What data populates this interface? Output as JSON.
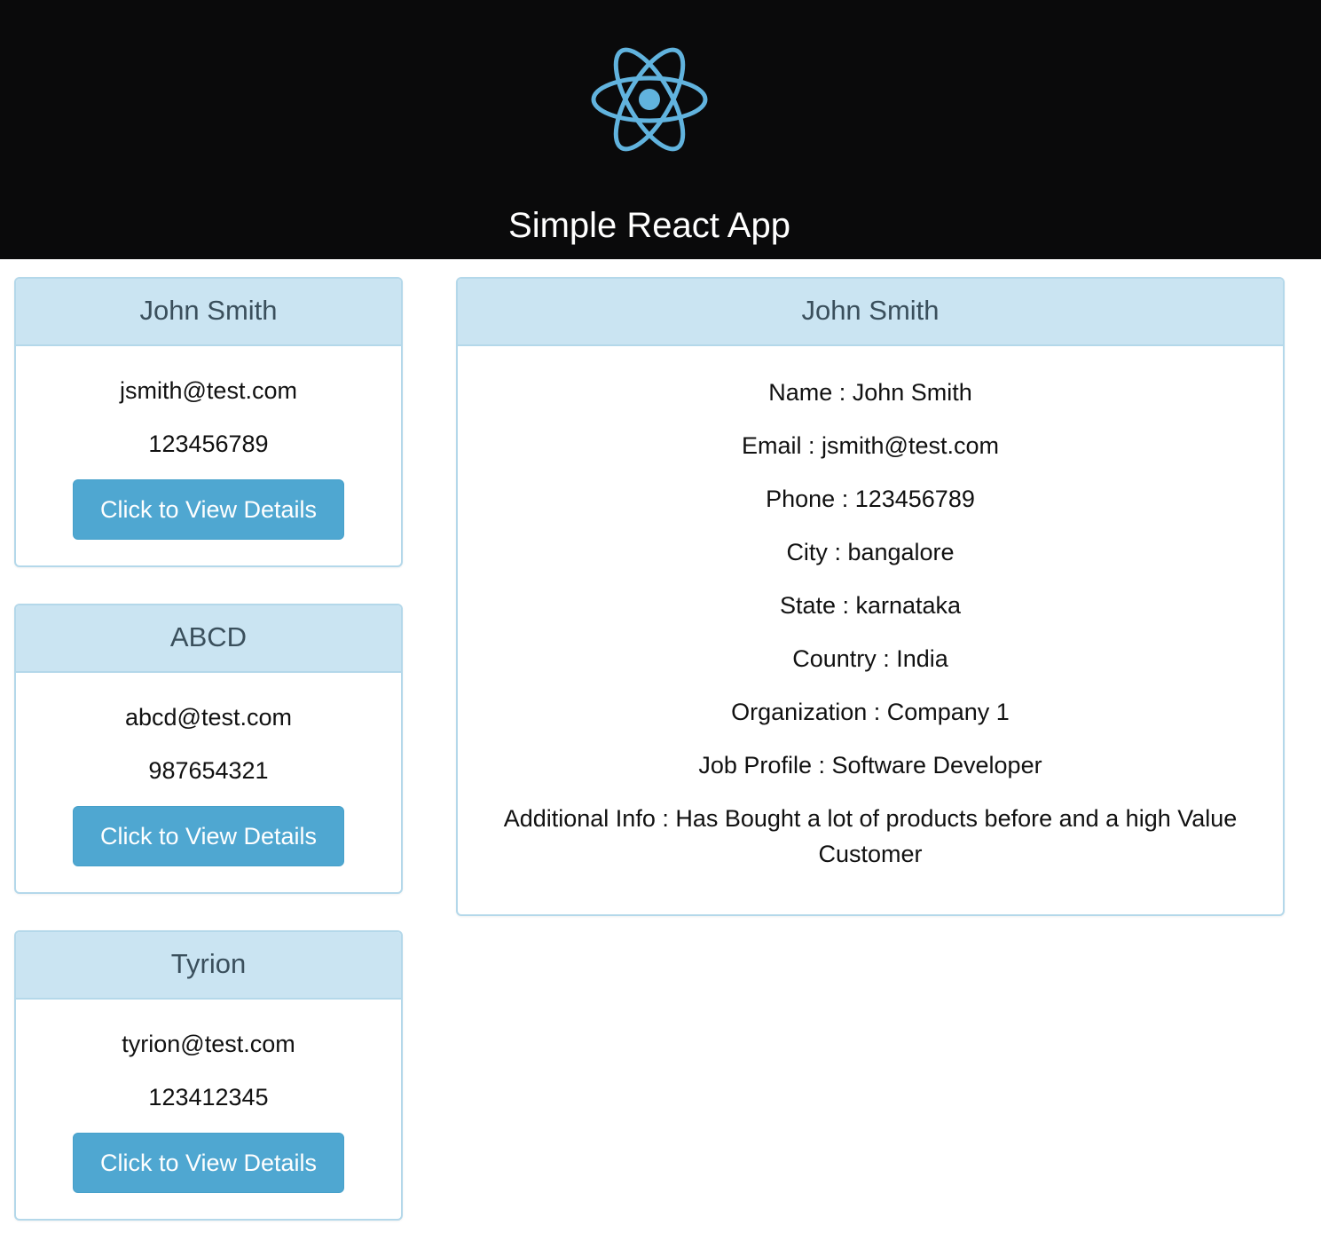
{
  "header": {
    "logo_icon": "react-atom-icon",
    "title": "Simple React App",
    "background": "#0a0a0b",
    "logo_color": "#61b3de"
  },
  "customers": [
    {
      "name": "John Smith",
      "email": "jsmith@test.com",
      "phone": "123456789",
      "button_label": "Click to View Details"
    },
    {
      "name": "ABCD",
      "email": "abcd@test.com",
      "phone": "987654321",
      "button_label": "Click to View Details"
    },
    {
      "name": "Tyrion",
      "email": "tyrion@test.com",
      "phone": "123412345",
      "button_label": "Click to View Details"
    }
  ],
  "details": {
    "heading": "John Smith",
    "rows": [
      "Name : John Smith",
      "Email : jsmith@test.com",
      "Phone : 123456789",
      "City : bangalore",
      "State : karnataka",
      "Country : India",
      "Organization : Company 1",
      "Job Profile : Software Developer",
      "Additional Info : Has Bought a lot of products before and a high Value Customer"
    ]
  },
  "colors": {
    "panel_heading_bg": "#cae4f2",
    "panel_border": "#b4d8ea",
    "button_bg": "#4fa7d1"
  }
}
